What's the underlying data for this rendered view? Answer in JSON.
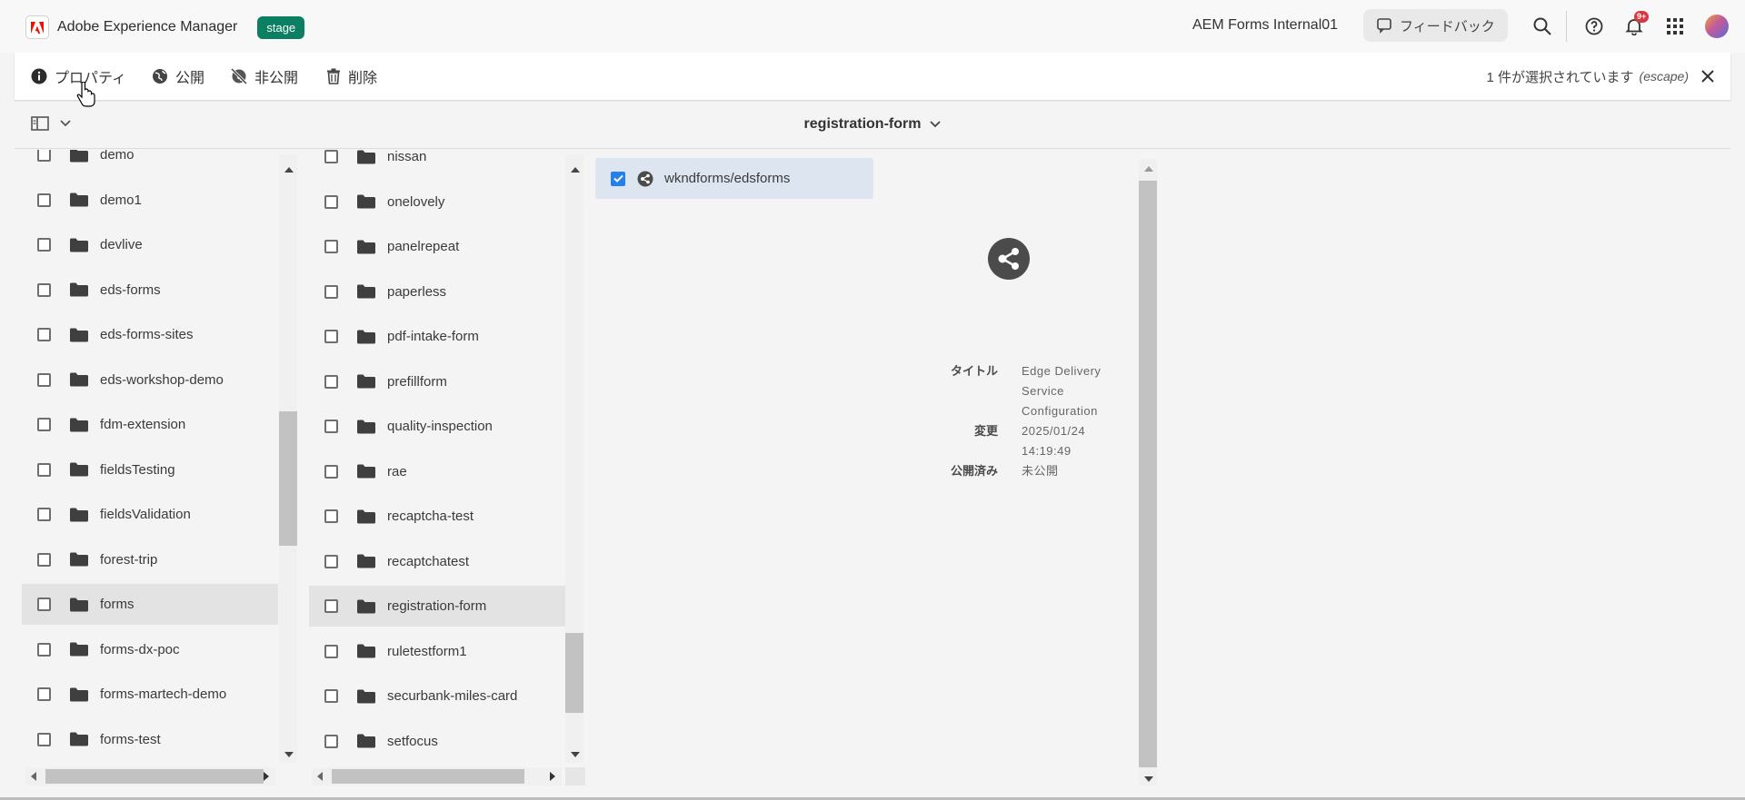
{
  "header": {
    "app_title": "Adobe Experience Manager",
    "env_badge": "stage",
    "org_name": "AEM Forms Internal01",
    "feedback_label": "フィードバック",
    "notification_count": "9+"
  },
  "actionbar": {
    "properties_label": "プロパティ",
    "publish_label": "公開",
    "unpublish_label": "非公開",
    "delete_label": "削除",
    "selection_text": "1 件が選択されています",
    "escape_hint": "(escape)"
  },
  "breadcrumb": {
    "title": "registration-form"
  },
  "column1": {
    "items": [
      {
        "label": "demo"
      },
      {
        "label": "demo1"
      },
      {
        "label": "devlive"
      },
      {
        "label": "eds-forms"
      },
      {
        "label": "eds-forms-sites"
      },
      {
        "label": "eds-workshop-demo"
      },
      {
        "label": "fdm-extension"
      },
      {
        "label": "fieldsTesting"
      },
      {
        "label": "fieldsValidation"
      },
      {
        "label": "forest-trip"
      },
      {
        "label": "forms"
      },
      {
        "label": "forms-dx-poc"
      },
      {
        "label": "forms-martech-demo"
      },
      {
        "label": "forms-test"
      }
    ],
    "selected": "forms"
  },
  "column2": {
    "items": [
      {
        "label": "nissan"
      },
      {
        "label": "onelovely"
      },
      {
        "label": "panelrepeat"
      },
      {
        "label": "paperless"
      },
      {
        "label": "pdf-intake-form"
      },
      {
        "label": "prefillform"
      },
      {
        "label": "quality-inspection"
      },
      {
        "label": "rae"
      },
      {
        "label": "recaptcha-test"
      },
      {
        "label": "recaptchatest"
      },
      {
        "label": "registration-form"
      },
      {
        "label": "ruletestform1"
      },
      {
        "label": "securbank-miles-card"
      },
      {
        "label": "setfocus"
      }
    ],
    "selected": "registration-form"
  },
  "column3": {
    "item_label": "wkndforms/edsforms"
  },
  "preview": {
    "title_key": "タイトル",
    "title_value": "Edge Delivery Service Configuration",
    "modified_key": "変更",
    "modified_value": "2025/01/24 14:19:49",
    "published_key": "公開済み",
    "published_value": "未公開"
  },
  "colors": {
    "env_badge": "#0b7f62",
    "accent_blue": "#2680eb",
    "notification_red": "#d7373f",
    "selected_row": "#e3e3e3",
    "selected_card": "#dde6f0"
  }
}
